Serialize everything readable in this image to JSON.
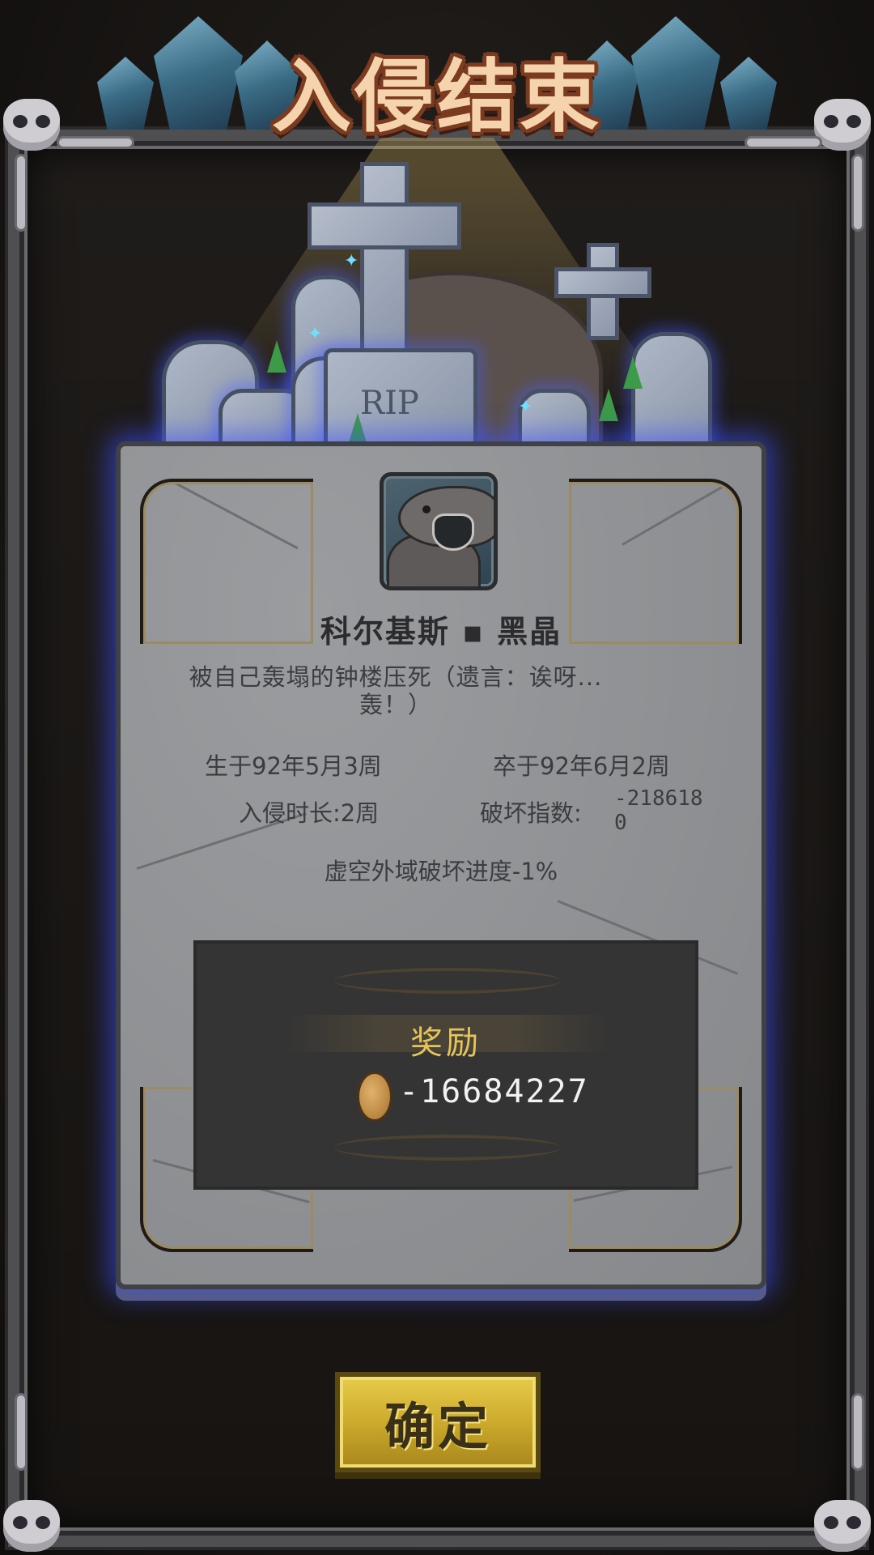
{
  "screen": {
    "title": "入侵结束"
  },
  "graveyard": {
    "headstone_text": "RIP"
  },
  "hero": {
    "name": "科尔基斯 ▪ 黑晶",
    "epitaph": "被自己轰塌的钟楼压死（遗言：诶呀...轰！）"
  },
  "stats": {
    "born": "生于92年5月3周",
    "died": "卒于92年6月2周",
    "duration": "入侵时长:2周",
    "destruction_label": "破坏指数:",
    "destruction_value": "-2186180",
    "void_progress": "虚空外域破坏进度-1%"
  },
  "reward": {
    "title": "奖励",
    "icon": "gold-coin-icon",
    "value": "-16684227"
  },
  "confirm": {
    "label": "确定"
  },
  "colors": {
    "title": "#f4d3ad",
    "reward_title": "#e5c55b",
    "button": "#d9b93a",
    "glow": "#3c50ff"
  }
}
